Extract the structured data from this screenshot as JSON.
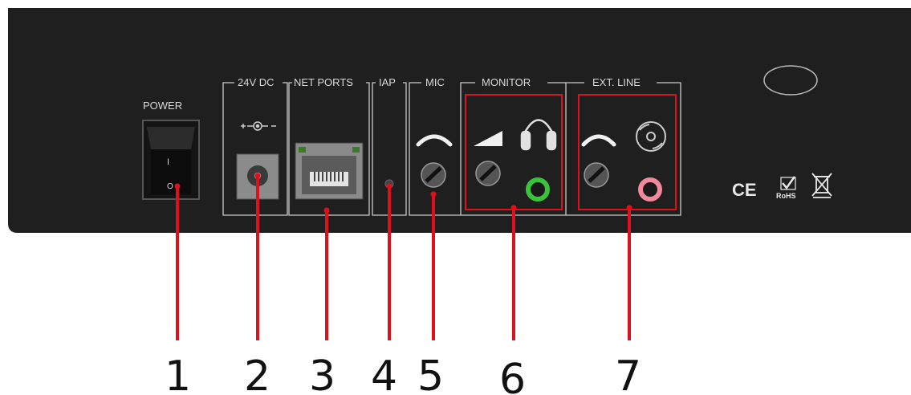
{
  "panel": {
    "labels": {
      "power": "POWER",
      "dc": "24V DC",
      "net": "NET PORTS",
      "iap": "IAP",
      "mic": "MIC",
      "monitor": "MONITOR",
      "ext": "EXT. LINE"
    },
    "switch_marks": {
      "on": "I",
      "off": "O"
    },
    "certifications": {
      "ce": "CE",
      "rohs": "RoHS"
    },
    "colors": {
      "panel": "#1f1f1f",
      "callout": "#e0101a",
      "monitor_jack": "#39c43a",
      "ext_jack": "#f2899a",
      "silkscreen": "#d8d8d8"
    }
  },
  "callouts": [
    "1",
    "2",
    "3",
    "4",
    "5",
    "6",
    "7"
  ],
  "icons": [
    "power-switch-icon",
    "dc-polarity-icon",
    "rj45-port-icon",
    "iap-hole-icon",
    "mic-gain-arc-icon",
    "volume-ramp-icon",
    "headphones-icon",
    "ext-gain-arc-icon",
    "cd-disc-icon",
    "ce-mark-icon",
    "rohs-icon",
    "weee-bin-icon"
  ]
}
